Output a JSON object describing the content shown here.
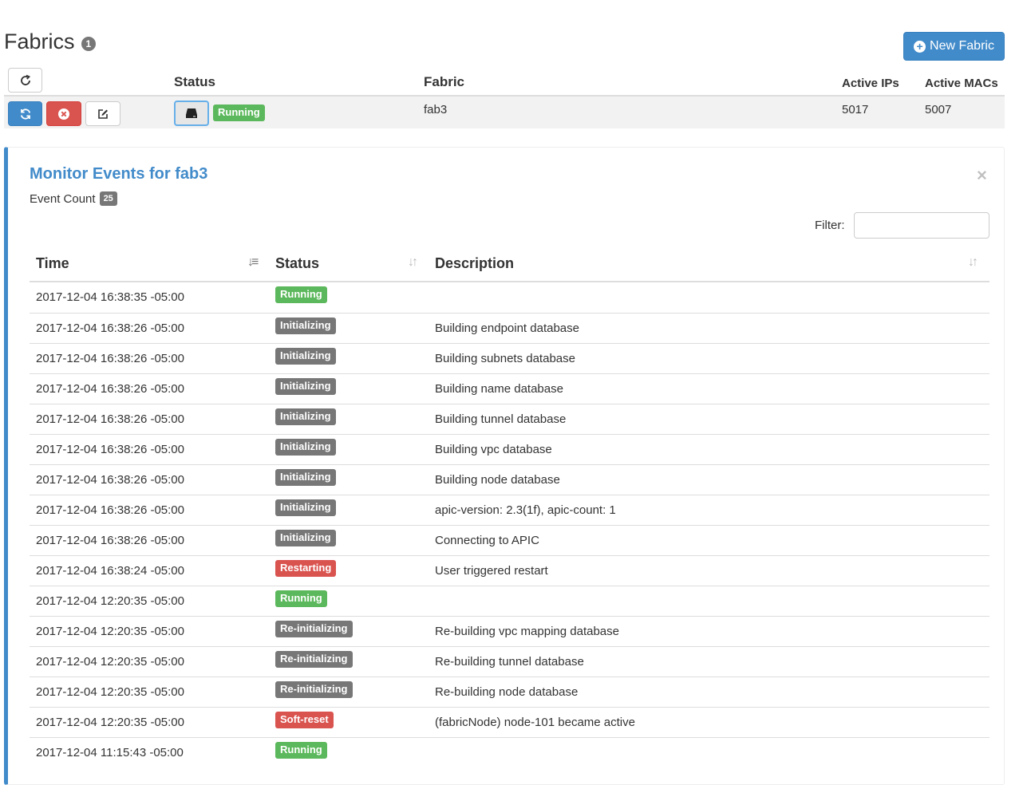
{
  "header": {
    "title": "Fabrics",
    "count": "1",
    "new_fabric_label": "New Fabric"
  },
  "fabric_table": {
    "columns": {
      "status": "Status",
      "fabric": "Fabric",
      "active_ips": "Active IPs",
      "active_macs": "Active MACs"
    },
    "row": {
      "status": "Running",
      "fabric": "fab3",
      "active_ips": "5017",
      "active_macs": "5007"
    }
  },
  "events_panel": {
    "title": "Monitor Events for fab3",
    "event_count_label": "Event Count",
    "event_count": "25",
    "close_symbol": "×",
    "filter_label": "Filter:",
    "filter_value": "",
    "columns": {
      "time": "Time",
      "status": "Status",
      "description": "Description"
    },
    "rows": [
      {
        "time": "2017-12-04 16:38:35 -05:00",
        "status": "Running",
        "status_type": "success",
        "description": ""
      },
      {
        "time": "2017-12-04 16:38:26 -05:00",
        "status": "Initializing",
        "status_type": "default",
        "description": "Building endpoint database"
      },
      {
        "time": "2017-12-04 16:38:26 -05:00",
        "status": "Initializing",
        "status_type": "default",
        "description": "Building subnets database"
      },
      {
        "time": "2017-12-04 16:38:26 -05:00",
        "status": "Initializing",
        "status_type": "default",
        "description": "Building name database"
      },
      {
        "time": "2017-12-04 16:38:26 -05:00",
        "status": "Initializing",
        "status_type": "default",
        "description": "Building tunnel database"
      },
      {
        "time": "2017-12-04 16:38:26 -05:00",
        "status": "Initializing",
        "status_type": "default",
        "description": "Building vpc database"
      },
      {
        "time": "2017-12-04 16:38:26 -05:00",
        "status": "Initializing",
        "status_type": "default",
        "description": "Building node database"
      },
      {
        "time": "2017-12-04 16:38:26 -05:00",
        "status": "Initializing",
        "status_type": "default",
        "description": "apic-version: 2.3(1f), apic-count: 1"
      },
      {
        "time": "2017-12-04 16:38:26 -05:00",
        "status": "Initializing",
        "status_type": "default",
        "description": "Connecting to APIC"
      },
      {
        "time": "2017-12-04 16:38:24 -05:00",
        "status": "Restarting",
        "status_type": "danger",
        "description": "User triggered restart"
      },
      {
        "time": "2017-12-04 12:20:35 -05:00",
        "status": "Running",
        "status_type": "success",
        "description": ""
      },
      {
        "time": "2017-12-04 12:20:35 -05:00",
        "status": "Re-initializing",
        "status_type": "default",
        "description": "Re-building vpc mapping database"
      },
      {
        "time": "2017-12-04 12:20:35 -05:00",
        "status": "Re-initializing",
        "status_type": "default",
        "description": "Re-building tunnel database"
      },
      {
        "time": "2017-12-04 12:20:35 -05:00",
        "status": "Re-initializing",
        "status_type": "default",
        "description": "Re-building node database"
      },
      {
        "time": "2017-12-04 12:20:35 -05:00",
        "status": "Soft-reset",
        "status_type": "danger",
        "description": "(fabricNode) node-101 became active"
      },
      {
        "time": "2017-12-04 11:15:43 -05:00",
        "status": "Running",
        "status_type": "success",
        "description": ""
      }
    ]
  },
  "colors": {
    "primary": "#428bca",
    "success": "#5cb85c",
    "danger": "#d9534f",
    "default": "#777777"
  },
  "icons": {
    "refresh": "refresh-icon",
    "sync": "sync-icon",
    "stop": "stop-circle-icon",
    "edit": "edit-icon",
    "server": "server-icon",
    "plus": "plus-circle-icon",
    "sort": "sort-icon"
  }
}
